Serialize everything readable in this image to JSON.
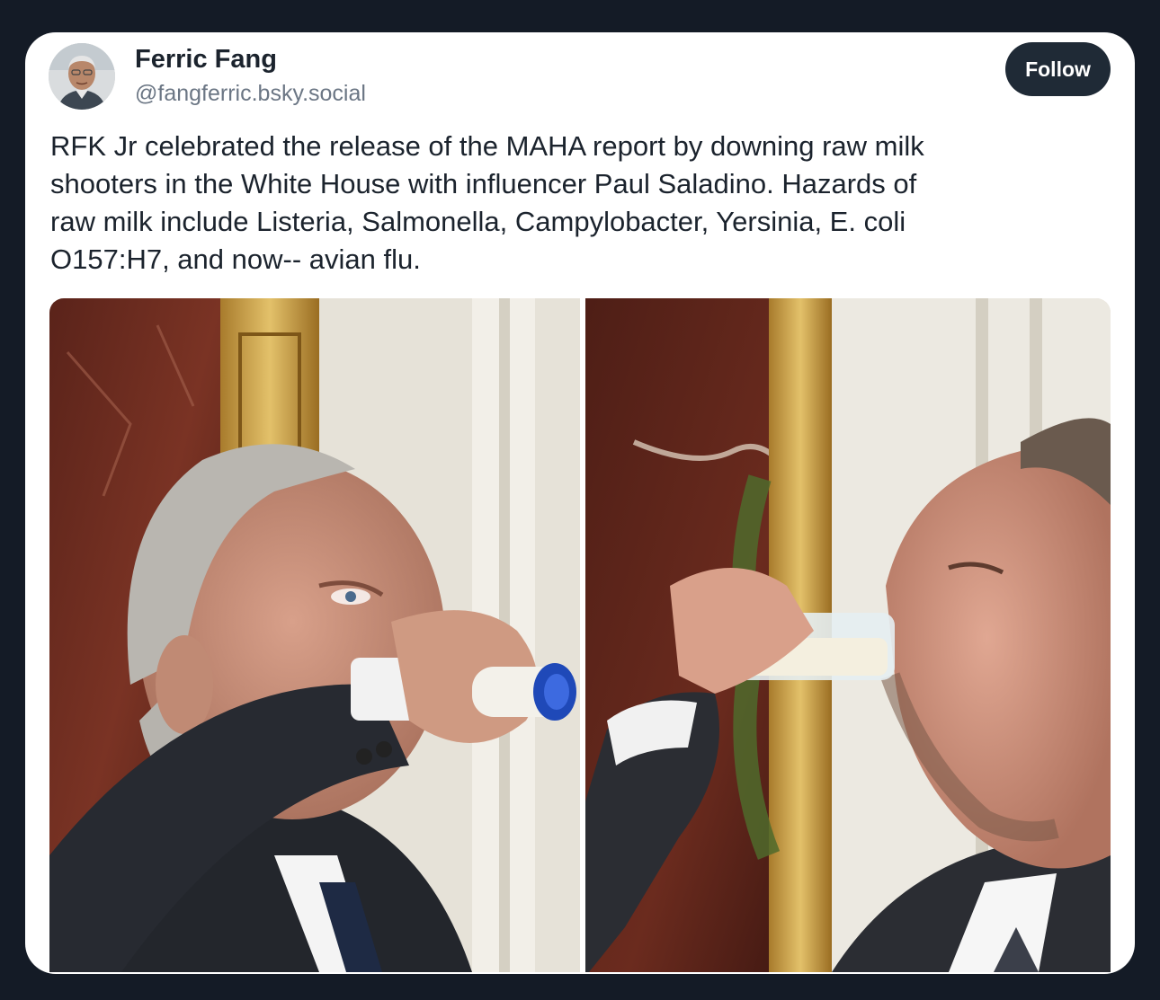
{
  "post": {
    "author": {
      "display_name": "Ferric Fang",
      "handle": "@fangferric.bsky.social"
    },
    "follow_label": "Follow",
    "text_lines": [
      "RFK Jr celebrated the release of the MAHA report by downing raw milk",
      "shooters in the White House with influencer Paul Saladino. Hazards of",
      "raw milk include Listeria, Salmonella, Campylobacter, Yersinia, E. coli",
      "O157:H7, and now-- avian flu."
    ]
  },
  "colors": {
    "page_background": "#141b26",
    "card_background": "#ffffff",
    "text_primary": "#1b232d",
    "text_secondary": "#6b7684",
    "follow_button": "#1f2a36"
  }
}
